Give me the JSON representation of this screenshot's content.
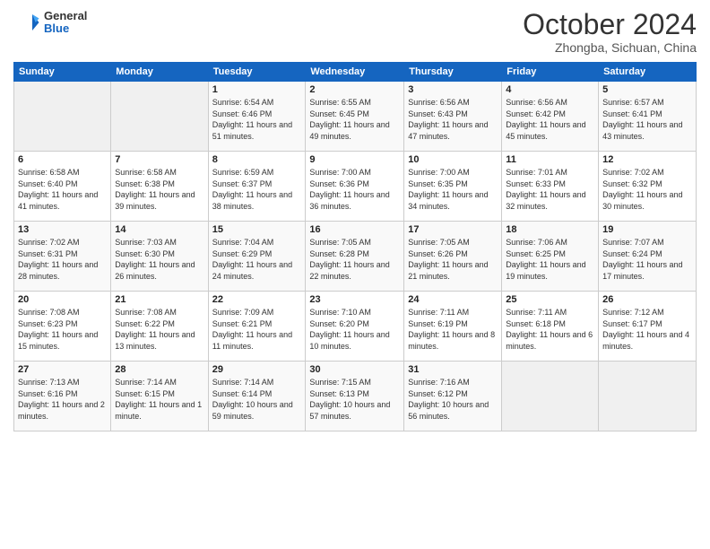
{
  "logo": {
    "general": "General",
    "blue": "Blue"
  },
  "title": "October 2024",
  "subtitle": "Zhongba, Sichuan, China",
  "days_header": [
    "Sunday",
    "Monday",
    "Tuesday",
    "Wednesday",
    "Thursday",
    "Friday",
    "Saturday"
  ],
  "weeks": [
    [
      {
        "day": "",
        "info": ""
      },
      {
        "day": "",
        "info": ""
      },
      {
        "day": "1",
        "sunrise": "6:54 AM",
        "sunset": "6:46 PM",
        "daylight": "11 hours and 51 minutes."
      },
      {
        "day": "2",
        "sunrise": "6:55 AM",
        "sunset": "6:45 PM",
        "daylight": "11 hours and 49 minutes."
      },
      {
        "day": "3",
        "sunrise": "6:56 AM",
        "sunset": "6:43 PM",
        "daylight": "11 hours and 47 minutes."
      },
      {
        "day": "4",
        "sunrise": "6:56 AM",
        "sunset": "6:42 PM",
        "daylight": "11 hours and 45 minutes."
      },
      {
        "day": "5",
        "sunrise": "6:57 AM",
        "sunset": "6:41 PM",
        "daylight": "11 hours and 43 minutes."
      }
    ],
    [
      {
        "day": "6",
        "sunrise": "6:58 AM",
        "sunset": "6:40 PM",
        "daylight": "11 hours and 41 minutes."
      },
      {
        "day": "7",
        "sunrise": "6:58 AM",
        "sunset": "6:38 PM",
        "daylight": "11 hours and 39 minutes."
      },
      {
        "day": "8",
        "sunrise": "6:59 AM",
        "sunset": "6:37 PM",
        "daylight": "11 hours and 38 minutes."
      },
      {
        "day": "9",
        "sunrise": "7:00 AM",
        "sunset": "6:36 PM",
        "daylight": "11 hours and 36 minutes."
      },
      {
        "day": "10",
        "sunrise": "7:00 AM",
        "sunset": "6:35 PM",
        "daylight": "11 hours and 34 minutes."
      },
      {
        "day": "11",
        "sunrise": "7:01 AM",
        "sunset": "6:33 PM",
        "daylight": "11 hours and 32 minutes."
      },
      {
        "day": "12",
        "sunrise": "7:02 AM",
        "sunset": "6:32 PM",
        "daylight": "11 hours and 30 minutes."
      }
    ],
    [
      {
        "day": "13",
        "sunrise": "7:02 AM",
        "sunset": "6:31 PM",
        "daylight": "11 hours and 28 minutes."
      },
      {
        "day": "14",
        "sunrise": "7:03 AM",
        "sunset": "6:30 PM",
        "daylight": "11 hours and 26 minutes."
      },
      {
        "day": "15",
        "sunrise": "7:04 AM",
        "sunset": "6:29 PM",
        "daylight": "11 hours and 24 minutes."
      },
      {
        "day": "16",
        "sunrise": "7:05 AM",
        "sunset": "6:28 PM",
        "daylight": "11 hours and 22 minutes."
      },
      {
        "day": "17",
        "sunrise": "7:05 AM",
        "sunset": "6:26 PM",
        "daylight": "11 hours and 21 minutes."
      },
      {
        "day": "18",
        "sunrise": "7:06 AM",
        "sunset": "6:25 PM",
        "daylight": "11 hours and 19 minutes."
      },
      {
        "day": "19",
        "sunrise": "7:07 AM",
        "sunset": "6:24 PM",
        "daylight": "11 hours and 17 minutes."
      }
    ],
    [
      {
        "day": "20",
        "sunrise": "7:08 AM",
        "sunset": "6:23 PM",
        "daylight": "11 hours and 15 minutes."
      },
      {
        "day": "21",
        "sunrise": "7:08 AM",
        "sunset": "6:22 PM",
        "daylight": "11 hours and 13 minutes."
      },
      {
        "day": "22",
        "sunrise": "7:09 AM",
        "sunset": "6:21 PM",
        "daylight": "11 hours and 11 minutes."
      },
      {
        "day": "23",
        "sunrise": "7:10 AM",
        "sunset": "6:20 PM",
        "daylight": "11 hours and 10 minutes."
      },
      {
        "day": "24",
        "sunrise": "7:11 AM",
        "sunset": "6:19 PM",
        "daylight": "11 hours and 8 minutes."
      },
      {
        "day": "25",
        "sunrise": "7:11 AM",
        "sunset": "6:18 PM",
        "daylight": "11 hours and 6 minutes."
      },
      {
        "day": "26",
        "sunrise": "7:12 AM",
        "sunset": "6:17 PM",
        "daylight": "11 hours and 4 minutes."
      }
    ],
    [
      {
        "day": "27",
        "sunrise": "7:13 AM",
        "sunset": "6:16 PM",
        "daylight": "11 hours and 2 minutes."
      },
      {
        "day": "28",
        "sunrise": "7:14 AM",
        "sunset": "6:15 PM",
        "daylight": "11 hours and 1 minute."
      },
      {
        "day": "29",
        "sunrise": "7:14 AM",
        "sunset": "6:14 PM",
        "daylight": "10 hours and 59 minutes."
      },
      {
        "day": "30",
        "sunrise": "7:15 AM",
        "sunset": "6:13 PM",
        "daylight": "10 hours and 57 minutes."
      },
      {
        "day": "31",
        "sunrise": "7:16 AM",
        "sunset": "6:12 PM",
        "daylight": "10 hours and 56 minutes."
      },
      {
        "day": "",
        "info": ""
      },
      {
        "day": "",
        "info": ""
      }
    ]
  ]
}
